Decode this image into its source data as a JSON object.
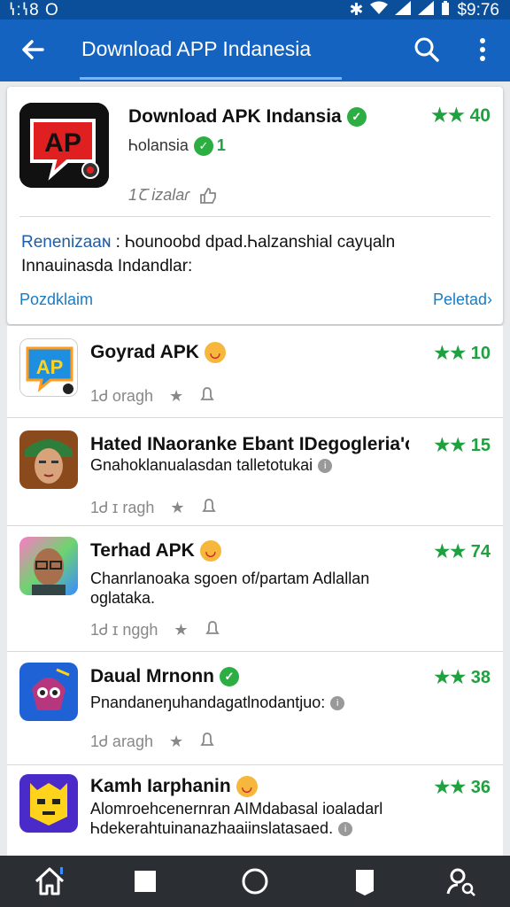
{
  "status_bar": {
    "time_left": "ꝇ:ꝇ8 O",
    "time_right": "$9:76"
  },
  "app_bar": {
    "title": "Download APP Indanesia",
    "back_icon": "back-arrow-icon",
    "search_icon": "search-icon",
    "more_icon": "more-vert-icon"
  },
  "featured": {
    "title": "Download APK Indansia",
    "developer": "Ꮒolansia",
    "developer_badge": "1",
    "rating": "★★ 40",
    "meta": "1Ꞇ izalaɾ",
    "desc_lead": "Renenizaaɴ",
    "desc_rest": ": Ꮒounoobd dpad.Ꮒalzanshial cayɥaln Innauinasda Indandlar:",
    "link_left": "Pozdklaim",
    "link_right": "Peletad"
  },
  "apps": [
    {
      "name": "Goyrad APK",
      "desc": "",
      "rating": "★★ 10",
      "meta": "1Ꮷ oragh"
    },
    {
      "name": "Hated INaoranke Ebant IDegogleria'ol",
      "desc": "Gnahoklanualasdan talletotukai",
      "rating": "★★ 15",
      "meta": "1Ꮷ ɪ ragh"
    },
    {
      "name": "Terhad APK",
      "desc": "Chanrlanoaka sgoen of/partam Adlallan oglataka.",
      "rating": "★★ 74",
      "meta": "1Ꮷ ɪ nggh"
    },
    {
      "name": "Daual Mrnonn",
      "desc": "Pnandaneŋuhandagatlnodantjuo:",
      "rating": "★★ 38",
      "meta": "1Ꮷ aragh"
    },
    {
      "name": "Kamh Iarphanin",
      "desc": "Alomroehcenernran AIMdabasal ioaladarl Ꮒdekerahtuinanazhaaiinslatasaed.",
      "rating": "★★ 36",
      "meta": ""
    }
  ],
  "nav": {
    "home": "home-icon",
    "recents": "recents-icon",
    "circle": "circle-home-icon",
    "bookmark": "bookmark-icon",
    "person": "person-search-icon"
  },
  "colors": {
    "app_bar": "#1463c0",
    "status_bar": "#0b4f9b",
    "rating_green": "#21a040",
    "link_blue": "#1a7cc4",
    "nav_bar": "#2b2f33"
  }
}
